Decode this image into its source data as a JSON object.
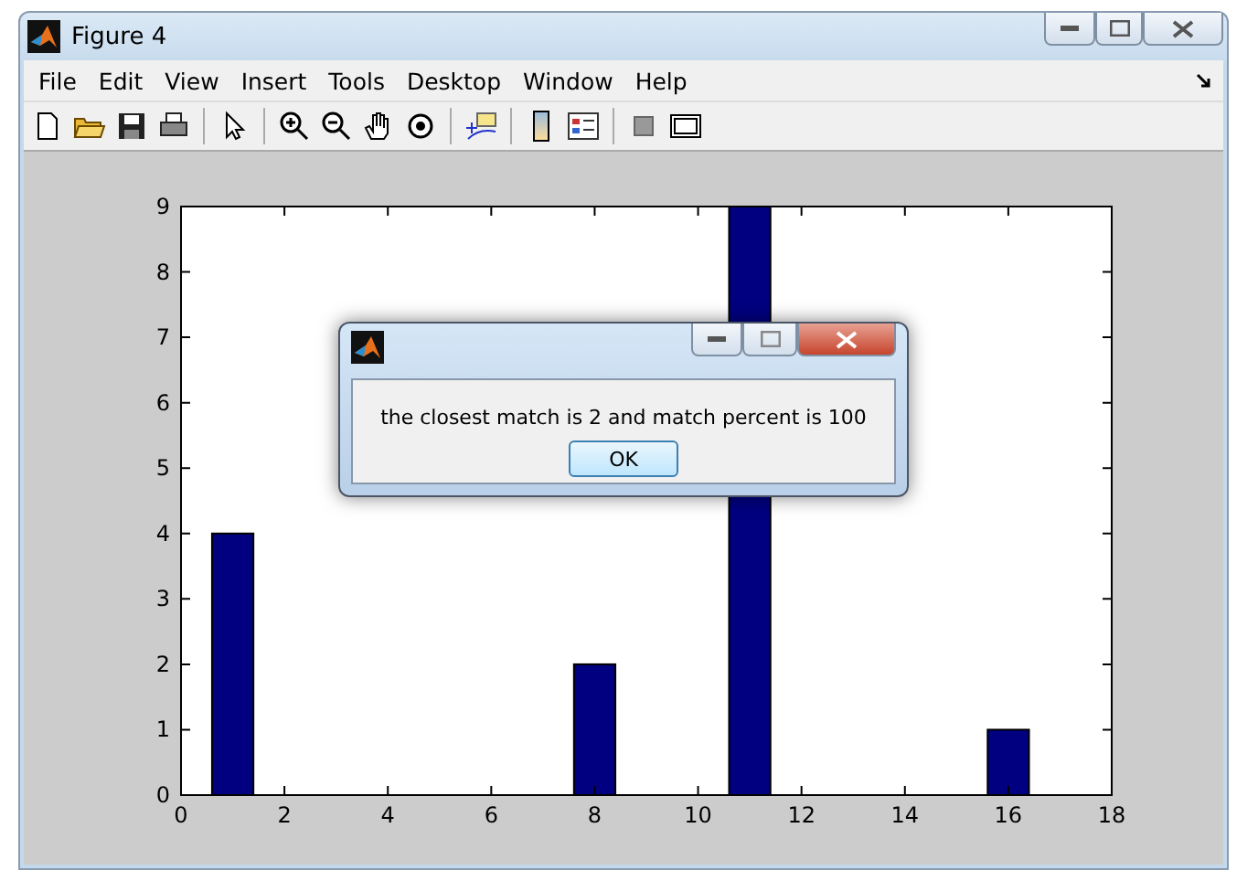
{
  "window": {
    "title": "Figure 4"
  },
  "menu": [
    "File",
    "Edit",
    "View",
    "Insert",
    "Tools",
    "Desktop",
    "Window",
    "Help"
  ],
  "chart_data": {
    "type": "bar",
    "x": [
      1,
      8,
      11,
      16
    ],
    "series": [
      {
        "color": "#000080",
        "values": [
          4,
          2,
          9,
          1
        ]
      }
    ],
    "xlim": [
      0,
      18
    ],
    "ylim": [
      0,
      9
    ],
    "xticks": [
      0,
      2,
      4,
      6,
      8,
      10,
      12,
      14,
      16,
      18
    ],
    "yticks": [
      0,
      1,
      2,
      3,
      4,
      5,
      6,
      7,
      8,
      9
    ]
  },
  "dialog": {
    "message": "the closest match is 2 and match percent is 100",
    "button": "OK"
  }
}
